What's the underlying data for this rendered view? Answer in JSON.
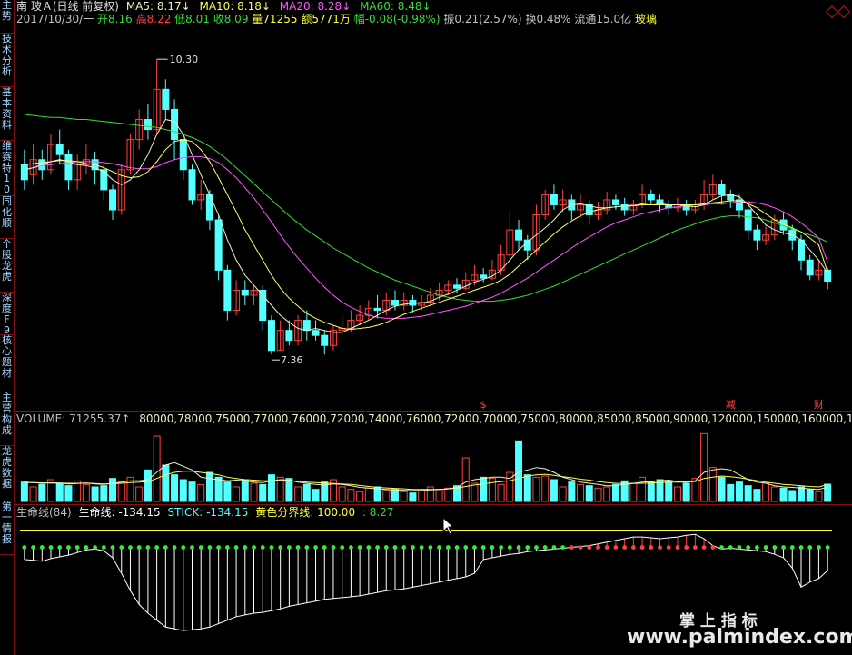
{
  "colors": {
    "ma5": "#f0f0c0",
    "ma10": "#ffff55",
    "ma20": "#ff55ff",
    "ma60": "#33dd33",
    "up": "#ff4040",
    "down": "#54ffff",
    "sep": "#8b1111",
    "cyan": "#54ffff",
    "yellow": "#ffff33"
  },
  "sidebar": {
    "tabs": [
      "主势",
      "技术分析",
      "基本资料",
      "维赛特10",
      "同化顺",
      "个股龙虎",
      "深度F9",
      "核心题材",
      "主营构成",
      "龙虎数据",
      "第一情报"
    ]
  },
  "header": {
    "stock": "南 玻Ａ(日线 前复权)",
    "ma5": "MA5: 8.17↓",
    "ma10": "MA10: 8.18↓",
    "ma20": "MA20: 8.28↓",
    "ma60": "MA60: 8.48↓",
    "date": "2017/10/30/一",
    "open": "开8.16",
    "high": "高8.22",
    "low": "低8.01",
    "close": "收8.09",
    "vol": "量71255",
    "amount": "额5771万",
    "change": "幅-0.08(-0.98%)",
    "amp": "振0.21(2.57%)",
    "turnover": "换0.48%",
    "float": "流通15.0亿",
    "industry": "玻璃"
  },
  "price_chart": {
    "high_label": "10.30",
    "low_label": "7.36",
    "ylim": [
      7.0,
      10.6
    ],
    "candles": [
      [
        9.25,
        9.1,
        9.4,
        9.0
      ],
      [
        9.15,
        9.3,
        9.45,
        9.05
      ],
      [
        9.3,
        9.2,
        9.4,
        9.1
      ],
      [
        9.2,
        9.45,
        9.55,
        9.15
      ],
      [
        9.45,
        9.35,
        9.6,
        9.25
      ],
      [
        9.35,
        9.1,
        9.4,
        9.0
      ],
      [
        9.1,
        9.25,
        9.35,
        9.0
      ],
      [
        9.25,
        9.3,
        9.45,
        9.15
      ],
      [
        9.3,
        9.2,
        9.38,
        9.05
      ],
      [
        9.2,
        9.0,
        9.25,
        8.9
      ],
      [
        9.0,
        8.8,
        9.05,
        8.7
      ],
      [
        8.8,
        9.2,
        9.25,
        8.75
      ],
      [
        9.2,
        9.5,
        9.55,
        9.15
      ],
      [
        9.5,
        9.7,
        9.8,
        9.4
      ],
      [
        9.7,
        9.6,
        9.85,
        9.5
      ],
      [
        9.6,
        10.0,
        10.3,
        9.55
      ],
      [
        10.0,
        9.8,
        10.1,
        9.7
      ],
      [
        9.8,
        9.5,
        9.9,
        9.3
      ],
      [
        9.5,
        9.2,
        9.55,
        9.1
      ],
      [
        9.2,
        8.9,
        9.25,
        8.85
      ],
      [
        8.9,
        8.95,
        9.1,
        8.8
      ],
      [
        8.95,
        8.7,
        9.0,
        8.6
      ],
      [
        8.7,
        8.2,
        8.75,
        8.1
      ],
      [
        8.2,
        7.8,
        8.25,
        7.7
      ],
      [
        7.8,
        8.0,
        8.1,
        7.75
      ],
      [
        8.0,
        7.95,
        8.1,
        7.85
      ],
      [
        7.95,
        8.0,
        8.05,
        7.85
      ],
      [
        8.0,
        7.7,
        8.05,
        7.6
      ],
      [
        7.7,
        7.4,
        7.75,
        7.36
      ],
      [
        7.4,
        7.6,
        7.7,
        7.4
      ],
      [
        7.6,
        7.5,
        7.7,
        7.45
      ],
      [
        7.5,
        7.7,
        7.75,
        7.45
      ],
      [
        7.7,
        7.6,
        7.8,
        7.5
      ],
      [
        7.6,
        7.55,
        7.7,
        7.5
      ],
      [
        7.55,
        7.45,
        7.6,
        7.36
      ],
      [
        7.45,
        7.6,
        7.65,
        7.4
      ],
      [
        7.6,
        7.62,
        7.75,
        7.55
      ],
      [
        7.62,
        7.7,
        7.8,
        7.58
      ],
      [
        7.7,
        7.75,
        7.85,
        7.65
      ],
      [
        7.75,
        7.82,
        7.9,
        7.7
      ],
      [
        7.82,
        7.8,
        7.95,
        7.72
      ],
      [
        7.8,
        7.9,
        7.98,
        7.75
      ],
      [
        7.9,
        7.85,
        8.0,
        7.8
      ],
      [
        7.85,
        7.9,
        7.98,
        7.8
      ],
      [
        7.9,
        7.85,
        7.95,
        7.78
      ],
      [
        7.85,
        7.88,
        7.95,
        7.8
      ],
      [
        7.88,
        7.95,
        8.02,
        7.84
      ],
      [
        7.95,
        8.0,
        8.08,
        7.9
      ],
      [
        8.0,
        8.05,
        8.1,
        7.95
      ],
      [
        8.05,
        8.02,
        8.12,
        7.97
      ],
      [
        8.02,
        8.1,
        8.18,
        8.0
      ],
      [
        8.1,
        8.15,
        8.25,
        8.05
      ],
      [
        8.15,
        8.12,
        8.22,
        8.08
      ],
      [
        8.12,
        8.2,
        8.3,
        8.1
      ],
      [
        8.2,
        8.35,
        8.45,
        8.15
      ],
      [
        8.35,
        8.6,
        8.8,
        8.3
      ],
      [
        8.6,
        8.5,
        8.7,
        8.4
      ],
      [
        8.5,
        8.4,
        8.55,
        8.3
      ],
      [
        8.4,
        8.75,
        8.85,
        8.35
      ],
      [
        8.75,
        8.95,
        9.0,
        8.7
      ],
      [
        8.95,
        8.85,
        9.05,
        8.8
      ],
      [
        8.85,
        8.9,
        9.0,
        8.78
      ],
      [
        8.9,
        8.8,
        8.95,
        8.7
      ],
      [
        8.8,
        8.85,
        8.95,
        8.72
      ],
      [
        8.85,
        8.75,
        8.9,
        8.65
      ],
      [
        8.75,
        8.8,
        8.88,
        8.7
      ],
      [
        8.8,
        8.9,
        8.98,
        8.75
      ],
      [
        8.9,
        8.85,
        8.95,
        8.8
      ],
      [
        8.85,
        8.8,
        8.92,
        8.74
      ],
      [
        8.8,
        8.85,
        8.9,
        8.75
      ],
      [
        8.85,
        8.95,
        9.05,
        8.82
      ],
      [
        8.95,
        8.9,
        9.0,
        8.85
      ],
      [
        8.9,
        8.85,
        8.95,
        8.78
      ],
      [
        8.85,
        8.82,
        8.9,
        8.75
      ],
      [
        8.82,
        8.85,
        8.92,
        8.78
      ],
      [
        8.85,
        8.8,
        8.9,
        8.74
      ],
      [
        8.8,
        8.85,
        8.9,
        8.76
      ],
      [
        8.85,
        8.95,
        9.1,
        8.8
      ],
      [
        8.95,
        9.05,
        9.15,
        8.9
      ],
      [
        9.05,
        8.95,
        9.1,
        8.85
      ],
      [
        8.95,
        8.9,
        9.0,
        8.82
      ],
      [
        8.9,
        8.8,
        8.95,
        8.72
      ],
      [
        8.8,
        8.6,
        8.85,
        8.5
      ],
      [
        8.6,
        8.5,
        8.65,
        8.4
      ],
      [
        8.5,
        8.55,
        8.65,
        8.45
      ],
      [
        8.55,
        8.7,
        8.75,
        8.5
      ],
      [
        8.7,
        8.6,
        8.78,
        8.55
      ],
      [
        8.6,
        8.5,
        8.65,
        8.4
      ],
      [
        8.5,
        8.3,
        8.55,
        8.2
      ],
      [
        8.3,
        8.15,
        8.35,
        8.1
      ],
      [
        8.15,
        8.2,
        8.3,
        8.1
      ],
      [
        8.2,
        8.09,
        8.22,
        8.01
      ]
    ],
    "ma5": [
      9.2,
      9.22,
      9.25,
      9.28,
      9.3,
      9.28,
      9.25,
      9.24,
      9.22,
      9.18,
      9.1,
      9.05,
      9.1,
      9.2,
      9.35,
      9.55,
      9.7,
      9.68,
      9.55,
      9.35,
      9.15,
      8.95,
      8.75,
      8.5,
      8.3,
      8.15,
      8.05,
      7.95,
      7.85,
      7.75,
      7.68,
      7.62,
      7.6,
      7.62,
      7.6,
      7.58,
      7.58,
      7.62,
      7.66,
      7.7,
      7.75,
      7.8,
      7.84,
      7.86,
      7.87,
      7.87,
      7.89,
      7.93,
      7.96,
      8.0,
      8.04,
      8.08,
      8.11,
      8.14,
      8.2,
      8.3,
      8.4,
      8.48,
      8.55,
      8.62,
      8.7,
      8.8,
      8.85,
      8.86,
      8.84,
      8.82,
      8.82,
      8.83,
      8.84,
      8.84,
      8.86,
      8.87,
      8.86,
      8.85,
      8.85,
      8.84,
      8.83,
      8.85,
      8.9,
      8.94,
      8.95,
      8.93,
      8.85,
      8.75,
      8.65,
      8.6,
      8.57,
      8.55,
      8.5,
      8.4,
      8.3,
      8.17
    ],
    "ma10": [
      9.25,
      9.26,
      9.27,
      9.28,
      9.29,
      9.29,
      9.28,
      9.26,
      9.25,
      9.22,
      9.18,
      9.14,
      9.12,
      9.13,
      9.18,
      9.28,
      9.4,
      9.48,
      9.5,
      9.48,
      9.4,
      9.28,
      9.12,
      8.95,
      8.78,
      8.6,
      8.45,
      8.3,
      8.15,
      8.02,
      7.92,
      7.84,
      7.77,
      7.72,
      7.68,
      7.65,
      7.62,
      7.61,
      7.62,
      7.63,
      7.65,
      7.68,
      7.72,
      7.76,
      7.79,
      7.82,
      7.85,
      7.88,
      7.91,
      7.94,
      7.97,
      8.0,
      8.03,
      8.06,
      8.1,
      8.16,
      8.24,
      8.32,
      8.4,
      8.48,
      8.56,
      8.63,
      8.69,
      8.74,
      8.78,
      8.8,
      8.82,
      8.83,
      8.84,
      8.84,
      8.85,
      8.85,
      8.85,
      8.85,
      8.85,
      8.85,
      8.85,
      8.86,
      8.87,
      8.88,
      8.89,
      8.89,
      8.86,
      8.82,
      8.76,
      8.7,
      8.66,
      8.62,
      8.58,
      8.52,
      8.45,
      8.18
    ],
    "ma20": [
      9.2,
      9.22,
      9.24,
      9.25,
      9.26,
      9.27,
      9.28,
      9.28,
      9.28,
      9.27,
      9.26,
      9.24,
      9.22,
      9.21,
      9.21,
      9.23,
      9.27,
      9.3,
      9.32,
      9.33,
      9.33,
      9.31,
      9.27,
      9.2,
      9.12,
      9.02,
      8.92,
      8.8,
      8.68,
      8.55,
      8.43,
      8.32,
      8.22,
      8.12,
      8.03,
      7.95,
      7.88,
      7.83,
      7.79,
      7.75,
      7.73,
      7.72,
      7.72,
      7.72,
      7.73,
      7.74,
      7.76,
      7.78,
      7.8,
      7.82,
      7.84,
      7.87,
      7.9,
      7.93,
      7.97,
      8.02,
      8.07,
      8.12,
      8.18,
      8.24,
      8.3,
      8.36,
      8.42,
      8.48,
      8.53,
      8.58,
      8.63,
      8.67,
      8.7,
      8.73,
      8.76,
      8.78,
      8.8,
      8.82,
      8.83,
      8.84,
      8.85,
      8.85,
      8.86,
      8.86,
      8.87,
      8.88,
      8.88,
      8.87,
      8.85,
      8.82,
      8.78,
      8.73,
      8.67,
      8.6,
      8.52,
      8.28
    ],
    "ma60": [
      9.75,
      9.74,
      9.73,
      9.72,
      9.72,
      9.71,
      9.7,
      9.7,
      9.69,
      9.68,
      9.67,
      9.66,
      9.65,
      9.64,
      9.63,
      9.62,
      9.6,
      9.58,
      9.55,
      9.52,
      9.48,
      9.43,
      9.37,
      9.3,
      9.22,
      9.14,
      9.06,
      8.98,
      8.9,
      8.82,
      8.74,
      8.67,
      8.6,
      8.54,
      8.48,
      8.42,
      8.37,
      8.32,
      8.27,
      8.22,
      8.18,
      8.14,
      8.1,
      8.07,
      8.04,
      8.01,
      7.98,
      7.95,
      7.93,
      7.91,
      7.9,
      7.89,
      7.89,
      7.89,
      7.9,
      7.91,
      7.93,
      7.95,
      7.98,
      8.01,
      8.04,
      8.08,
      8.12,
      8.16,
      8.2,
      8.24,
      8.28,
      8.32,
      8.36,
      8.4,
      8.44,
      8.48,
      8.52,
      8.56,
      8.6,
      8.63,
      8.66,
      8.69,
      8.71,
      8.73,
      8.74,
      8.74,
      8.73,
      8.72,
      8.7,
      8.67,
      8.64,
      8.61,
      8.58,
      8.55,
      8.52,
      8.48
    ],
    "markers": [
      {
        "idx": 52,
        "text": "$"
      },
      {
        "idx": 80,
        "text": "减"
      },
      {
        "idx": 90,
        "text": "财"
      }
    ]
  },
  "volume_panel": {
    "label": "VOLUME: 71255.37↑",
    "ma5": [
      80000,
      78000,
      75000,
      77000,
      76000,
      72000,
      74000,
      76000,
      72000,
      70000,
      75000,
      80000,
      85000,
      85000,
      90000,
      120000,
      150000,
      160000,
      145000,
      130000,
      100000,
      95000,
      90000,
      85000,
      88000,
      85000,
      80000,
      78000,
      85000,
      90000,
      88000,
      80000,
      75000,
      70000,
      68000,
      72000,
      70000,
      65000,
      58000,
      55000,
      52000,
      50000,
      48000,
      46000,
      45000,
      45000,
      48000,
      50000,
      52000,
      58000,
      80000,
      90000,
      95000,
      100000,
      100000,
      95000,
      120000,
      130000,
      140000,
      135000,
      120000,
      100000,
      90000,
      80000,
      75000,
      70000,
      65000,
      65000,
      70000,
      75000,
      80000,
      82000,
      85000,
      88000,
      82000,
      80000,
      85000,
      120000,
      130000,
      135000,
      130000,
      110000,
      90000,
      80000,
      75000,
      65000,
      60000,
      58000,
      55000,
      52000,
      50000,
      59203
    ],
    "ma10": [
      78000,
      78000,
      77000,
      76000,
      76000,
      75000,
      75000,
      76000,
      74000,
      72000,
      73000,
      75000,
      78000,
      80000,
      82000,
      95000,
      110000,
      120000,
      125000,
      125000,
      120000,
      115000,
      110000,
      100000,
      95000,
      90000,
      88000,
      85000,
      85000,
      86000,
      86000,
      84000,
      80000,
      78000,
      76000,
      74000,
      72000,
      70000,
      66000,
      62000,
      58000,
      56000,
      54000,
      52000,
      50000,
      50000,
      50000,
      50000,
      52000,
      55000,
      62000,
      68000,
      72000,
      78000,
      82000,
      85000,
      95000,
      105000,
      110000,
      112000,
      108000,
      102000,
      98000,
      92000,
      88000,
      82000,
      78000,
      75000,
      74000,
      74000,
      75000,
      76000,
      78000,
      80000,
      80000,
      80000,
      82000,
      95000,
      100000,
      105000,
      102000,
      98000,
      92000,
      86000,
      80000,
      75000,
      70000,
      68000,
      65000,
      62000,
      60000,
      69657
    ],
    "ylim": [
      0,
      300000
    ],
    "values": [
      80000,
      60000,
      70000,
      90000,
      75000,
      65000,
      85000,
      70000,
      60000,
      65000,
      95000,
      80000,
      100000,
      60000,
      130000,
      270000,
      150000,
      110000,
      90000,
      80000,
      70000,
      120000,
      100000,
      80000,
      60000,
      90000,
      75000,
      70000,
      110000,
      100000,
      95000,
      60000,
      70000,
      50000,
      80000,
      90000,
      60000,
      50000,
      40000,
      55000,
      60000,
      45000,
      50000,
      40000,
      35000,
      45000,
      60000,
      50000,
      55000,
      65000,
      180000,
      75000,
      100000,
      95000,
      70000,
      120000,
      250000,
      110000,
      100000,
      105000,
      90000,
      60000,
      80000,
      70000,
      65000,
      55000,
      60000,
      70000,
      85000,
      75000,
      100000,
      80000,
      90000,
      85000,
      60000,
      75000,
      95000,
      280000,
      140000,
      100000,
      70000,
      80000,
      65000,
      50000,
      75000,
      60000,
      55000,
      45000,
      60000,
      50000,
      40000,
      71255
    ]
  },
  "lifeline_panel": {
    "title": "生命线(84)",
    "life": "生命线: -134.15",
    "stick": "STICK: -134.15",
    "yellow": "黄色分界线: 100.00",
    "value": ": 8.27",
    "ylim": [
      -600,
      160
    ],
    "yellow_level": 100,
    "values": [
      -70,
      -75,
      -80,
      -65,
      -55,
      -45,
      -30,
      -15,
      -10,
      -20,
      -60,
      -150,
      -250,
      -330,
      -380,
      -420,
      -460,
      -470,
      -480,
      -475,
      -470,
      -460,
      -440,
      -420,
      -400,
      -390,
      -380,
      -375,
      -365,
      -355,
      -340,
      -330,
      -320,
      -310,
      -300,
      -295,
      -290,
      -285,
      -280,
      -270,
      -260,
      -250,
      -245,
      -240,
      -230,
      -220,
      -210,
      -200,
      -190,
      -180,
      -170,
      -150,
      -70,
      -60,
      -50,
      -40,
      -35,
      -25,
      -20,
      -15,
      -10,
      -5,
      0,
      5,
      10,
      20,
      30,
      40,
      50,
      60,
      60,
      55,
      50,
      55,
      60,
      70,
      75,
      50,
      10,
      -10,
      -5,
      -10,
      -15,
      -20,
      -25,
      -40,
      -60,
      -120,
      -230,
      -200,
      -180,
      -134
    ]
  },
  "watermark": {
    "cn": "掌 上 指 标",
    "url": "www.palmindex.com"
  }
}
